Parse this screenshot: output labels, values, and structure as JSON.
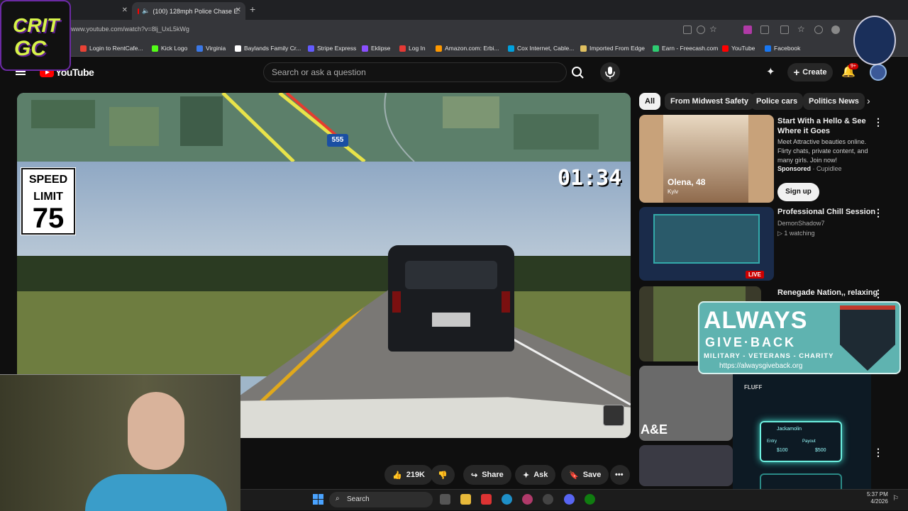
{
  "browser": {
    "tab1_label": "",
    "tab2_label": "(100) 128mph Police Chase E:",
    "url": "www.youtube.com/watch?v=8lj_UxL5kWg",
    "bookmarks": [
      {
        "label": "Login to RentCafe...",
        "color": "#e94235"
      },
      {
        "label": "Kick Logo",
        "color": "#53fc18"
      },
      {
        "label": "Virginia",
        "color": "#3b78e7"
      },
      {
        "label": "Baylands Family Cr...",
        "color": "#ffffff"
      },
      {
        "label": "Stripe Express",
        "color": "#635bff"
      },
      {
        "label": "Eklipse",
        "color": "#8a4fff"
      },
      {
        "label": "Log In",
        "color": "#e53935"
      },
      {
        "label": "Amazon.com: Erbi...",
        "color": "#ff9900"
      },
      {
        "label": "Cox Internet, Cable...",
        "color": "#00a1de"
      },
      {
        "label": "Imported From Edge",
        "color": "#e0c060"
      },
      {
        "label": "Earn - Freecash.com",
        "color": "#2ecc71"
      },
      {
        "label": "YouTube",
        "color": "#ff0000"
      },
      {
        "label": "Facebook",
        "color": "#1877f2"
      }
    ]
  },
  "youtube": {
    "logo_text": "YouTube",
    "search_placeholder": "Search or ask a question",
    "create_label": "Create",
    "notif_badge": "9+"
  },
  "video": {
    "speed_sign_line1": "SPEED",
    "speed_sign_line2": "LIMIT",
    "speed_sign_number": "75",
    "timer": "01:34",
    "route_number": "555",
    "actions": {
      "like_count": "219K",
      "share_label": "Share",
      "ask_label": "Ask",
      "save_label": "Save"
    }
  },
  "chips": [
    "All",
    "From Midwest Safety",
    "Police cars",
    "Politics News"
  ],
  "sidebar": {
    "ad": {
      "title": "Start With a Hello & See Where it Goes",
      "desc": "Meet Attractive beauties online. Flirty chats, private content, and many girls. Join now!",
      "sponsored": "Sponsored",
      "advertiser": "Cupidlee",
      "thumb_name": "Olena, 48",
      "thumb_loc": "Kyiv",
      "cta": "Sign up"
    },
    "items": [
      {
        "title": "Professional Chill Session",
        "channel": "DemonShadow7",
        "meta": "1 watching",
        "badge": "LIVE"
      },
      {
        "title": "Renegade Nation,, relaxing",
        "channel": "",
        "meta": "",
        "badge": ""
      }
    ],
    "ae_label": "A&E"
  },
  "overlays": {
    "crit_line1": "CRIT",
    "crit_line2": "GC",
    "agb_big": "ALWAYS",
    "agb_give": "GIVE·BACK",
    "agb_sub": "MILITARY - VETERANS - CHARITY",
    "agb_url": "https://alwaysgiveback.org",
    "fluff_label": "FLUFF",
    "fluff_card_title": "Jackamolin",
    "fluff_left_label": "Entry",
    "fluff_left_value": "$100",
    "fluff_right_label": "Payout",
    "fluff_right_value": "$500"
  },
  "taskbar": {
    "search_label": "Search",
    "time": "5:37 PM",
    "date": "4/2026"
  }
}
